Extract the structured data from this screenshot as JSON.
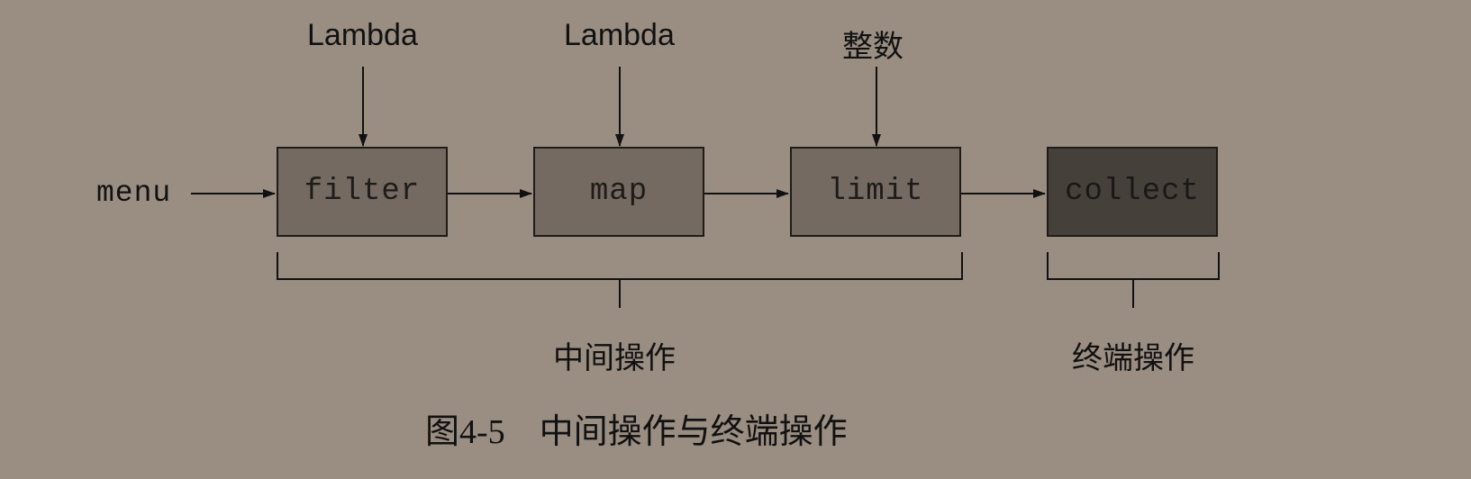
{
  "input_label": "menu",
  "steps": [
    {
      "name": "filter",
      "param": "Lambda",
      "kind": "intermediate"
    },
    {
      "name": "map",
      "param": "Lambda",
      "kind": "intermediate"
    },
    {
      "name": "limit",
      "param": "整数",
      "kind": "intermediate"
    },
    {
      "name": "collect",
      "param": "",
      "kind": "terminal"
    }
  ],
  "groups": {
    "intermediate": "中间操作",
    "terminal": "终端操作"
  },
  "caption": {
    "number": "图4-5",
    "text": "中间操作与终端操作"
  },
  "colors": {
    "background": "#9a8e82",
    "intermediate_box": "#746a61",
    "terminal_box": "#45403a"
  }
}
